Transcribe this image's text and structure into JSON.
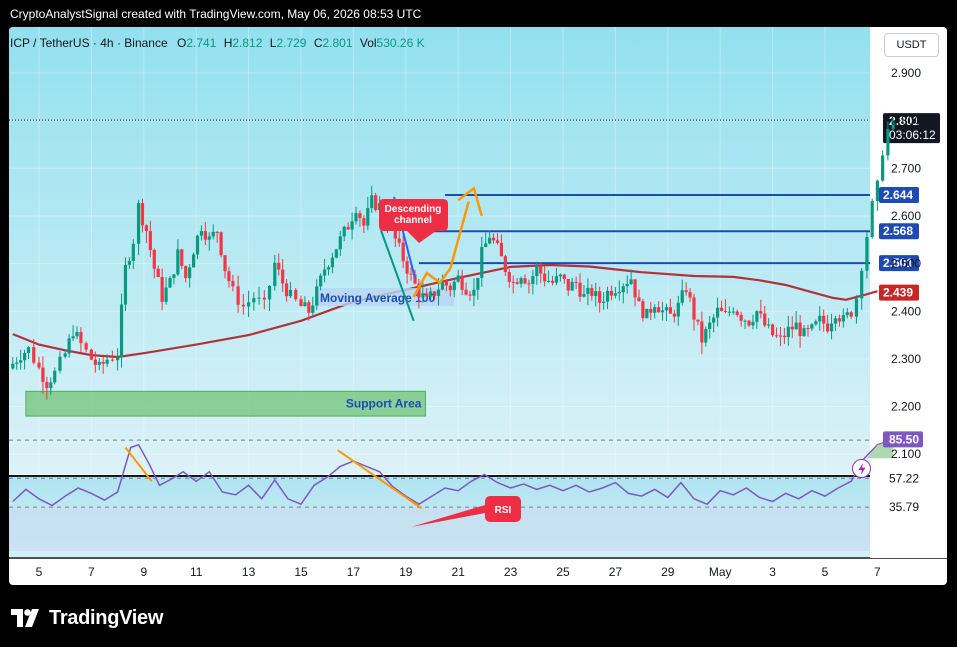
{
  "header": {
    "caption": "CryptoAnalystSignal created with TradingView.com, May 06, 2026 08:53 UTC"
  },
  "legend": {
    "symbol": "ICP / TetherUS · 4h · Binance",
    "open_label": "O",
    "open": "2.741",
    "high_label": "H",
    "high": "2.812",
    "low_label": "L",
    "low": "2.729",
    "close_label": "C",
    "close": "2.801",
    "vol_label": "Vol",
    "vol": "530.26 K"
  },
  "currency_button": "USDT",
  "brand": {
    "name": "TradingView",
    "icon": "tradingview-logo-icon"
  },
  "colors": {
    "bg_top": "#92e0ef",
    "bg_bottom": "#d7f1f6",
    "up": "#089981",
    "down": "#f23645",
    "ma": "#b2323a",
    "level": "#1e4bb3",
    "support_fill": "#7ec886",
    "rsi_line": "#7e57c2",
    "rsi_bg": "#c3e6f1",
    "annotation_red": "#ee2e45",
    "orange": "#ff9800",
    "teal": "#009688",
    "blue": "#2962ff"
  },
  "chart_data": {
    "type": "candlestick",
    "title": "ICP / TetherUS · 4h · Binance",
    "y_ticks": [
      "2.900",
      "2.800",
      "2.700",
      "2.600",
      "2.500",
      "2.400",
      "2.300",
      "2.200",
      "2.100"
    ],
    "y_range": [
      2.055,
      2.955
    ],
    "x_ticks": [
      "5",
      "7",
      "9",
      "11",
      "13",
      "15",
      "17",
      "19",
      "21",
      "23",
      "25",
      "27",
      "29",
      "May",
      "3",
      "5",
      "7"
    ],
    "current_price": {
      "value": 2.801,
      "label": "2.801",
      "countdown": "03:06:12"
    },
    "price_levels": [
      {
        "value": 2.644,
        "label": "2.644",
        "from": "Apr 21",
        "color": "#1e4bb3"
      },
      {
        "value": 2.568,
        "label": "2.568",
        "from": "Apr 20",
        "color": "#1e4bb3"
      },
      {
        "value": 2.501,
        "label": "2.501",
        "from": "Apr 20",
        "color": "#1e4bb3"
      }
    ],
    "moving_average": {
      "name": "Moving Average 100",
      "label_text": "Moving Average",
      "label_suffix": "100",
      "last_value": "2.439",
      "points": [
        [
          4.0,
          2.352
        ],
        [
          5.0,
          2.33
        ],
        [
          6.0,
          2.318
        ],
        [
          7.0,
          2.308
        ],
        [
          8.0,
          2.304
        ],
        [
          9.0,
          2.312
        ],
        [
          11.0,
          2.33
        ],
        [
          13.0,
          2.35
        ],
        [
          15.0,
          2.38
        ],
        [
          17.0,
          2.42
        ],
        [
          19.0,
          2.445
        ],
        [
          21.0,
          2.47
        ],
        [
          23.0,
          2.493
        ],
        [
          24.5,
          2.497
        ],
        [
          26.0,
          2.494
        ],
        [
          28.0,
          2.482
        ],
        [
          30.0,
          2.474
        ],
        [
          31.5,
          2.472
        ],
        [
          32.5,
          2.465
        ],
        [
          33.5,
          2.455
        ],
        [
          34.5,
          2.44
        ],
        [
          35.3,
          2.428
        ],
        [
          35.8,
          2.424
        ],
        [
          36.5,
          2.434
        ],
        [
          37.0,
          2.442
        ]
      ]
    },
    "support_area": {
      "label": "Support Area",
      "top": 2.232,
      "bottom": 2.18,
      "from": 4.5,
      "to": 19.75
    },
    "annotations": [
      {
        "text_line1": "Descending",
        "text_line2": "channel"
      },
      {
        "text": "RSI"
      }
    ],
    "close_path": [
      [
        4.0,
        2.29
      ],
      [
        4.3,
        2.31
      ],
      [
        4.6,
        2.32
      ],
      [
        5.0,
        2.28
      ],
      [
        5.3,
        2.25
      ],
      [
        5.6,
        2.27
      ],
      [
        6.0,
        2.31
      ],
      [
        6.3,
        2.36
      ],
      [
        6.6,
        2.33
      ],
      [
        7.0,
        2.3
      ],
      [
        7.3,
        2.28
      ],
      [
        7.6,
        2.3
      ],
      [
        8.0,
        2.31
      ],
      [
        8.3,
        2.49
      ],
      [
        8.6,
        2.55
      ],
      [
        8.8,
        2.62
      ],
      [
        9.1,
        2.57
      ],
      [
        9.4,
        2.49
      ],
      [
        9.7,
        2.43
      ],
      [
        10.0,
        2.46
      ],
      [
        10.3,
        2.52
      ],
      [
        10.6,
        2.47
      ],
      [
        10.9,
        2.53
      ],
      [
        11.2,
        2.58
      ],
      [
        11.5,
        2.55
      ],
      [
        11.8,
        2.57
      ],
      [
        12.1,
        2.49
      ],
      [
        12.4,
        2.44
      ],
      [
        12.8,
        2.41
      ],
      [
        13.2,
        2.43
      ],
      [
        13.6,
        2.41
      ],
      [
        14.0,
        2.5
      ],
      [
        14.3,
        2.46
      ],
      [
        14.6,
        2.43
      ],
      [
        15.0,
        2.41
      ],
      [
        15.3,
        2.4
      ],
      [
        15.6,
        2.44
      ],
      [
        15.9,
        2.49
      ],
      [
        16.2,
        2.52
      ],
      [
        16.5,
        2.55
      ],
      [
        16.8,
        2.58
      ],
      [
        17.1,
        2.62
      ],
      [
        17.4,
        2.58
      ],
      [
        17.7,
        2.63
      ],
      [
        18.0,
        2.62
      ],
      [
        18.3,
        2.59
      ],
      [
        18.6,
        2.55
      ],
      [
        18.9,
        2.51
      ],
      [
        19.2,
        2.47
      ],
      [
        19.5,
        2.44
      ],
      [
        19.8,
        2.42
      ],
      [
        20.1,
        2.44
      ],
      [
        20.4,
        2.46
      ],
      [
        20.7,
        2.45
      ],
      [
        21.0,
        2.47
      ],
      [
        21.3,
        2.45
      ],
      [
        21.6,
        2.44
      ],
      [
        21.9,
        2.52
      ],
      [
        22.2,
        2.56
      ],
      [
        22.5,
        2.53
      ],
      [
        22.8,
        2.49
      ],
      [
        23.1,
        2.46
      ],
      [
        23.4,
        2.48
      ],
      [
        23.7,
        2.46
      ],
      [
        24.0,
        2.49
      ],
      [
        24.3,
        2.47
      ],
      [
        24.6,
        2.46
      ],
      [
        24.9,
        2.47
      ],
      [
        25.2,
        2.45
      ],
      [
        25.5,
        2.46
      ],
      [
        25.8,
        2.43
      ],
      [
        26.1,
        2.44
      ],
      [
        26.4,
        2.42
      ],
      [
        26.7,
        2.44
      ],
      [
        27.0,
        2.45
      ],
      [
        27.3,
        2.46
      ],
      [
        27.6,
        2.47
      ],
      [
        27.9,
        2.41
      ],
      [
        28.2,
        2.39
      ],
      [
        28.5,
        2.42
      ],
      [
        28.8,
        2.4
      ],
      [
        29.1,
        2.39
      ],
      [
        29.4,
        2.41
      ],
      [
        29.7,
        2.45
      ],
      [
        30.0,
        2.39
      ],
      [
        30.3,
        2.34
      ],
      [
        30.6,
        2.37
      ],
      [
        30.9,
        2.4
      ],
      [
        31.2,
        2.39
      ],
      [
        31.5,
        2.41
      ],
      [
        31.8,
        2.39
      ],
      [
        32.1,
        2.38
      ],
      [
        32.4,
        2.4
      ],
      [
        32.7,
        2.37
      ],
      [
        33.0,
        2.35
      ],
      [
        33.3,
        2.34
      ],
      [
        33.6,
        2.36
      ],
      [
        33.9,
        2.37
      ],
      [
        34.2,
        2.35
      ],
      [
        34.5,
        2.36
      ],
      [
        34.8,
        2.38
      ],
      [
        35.1,
        2.37
      ],
      [
        35.4,
        2.4
      ],
      [
        35.7,
        2.38
      ],
      [
        36.0,
        2.4
      ],
      [
        36.2,
        2.43
      ],
      [
        36.4,
        2.5
      ],
      [
        36.6,
        2.56
      ],
      [
        36.8,
        2.62
      ],
      [
        37.0,
        2.66
      ],
      [
        37.2,
        2.74
      ],
      [
        37.4,
        2.78
      ],
      [
        37.6,
        2.8
      ]
    ],
    "rsi": {
      "levels": [
        "85.50",
        "57.22",
        "35.79"
      ],
      "values": [
        [
          4.0,
          40
        ],
        [
          4.5,
          49
        ],
        [
          5.0,
          42
        ],
        [
          5.5,
          37
        ],
        [
          6.0,
          44
        ],
        [
          6.5,
          50
        ],
        [
          7.0,
          46
        ],
        [
          7.5,
          41
        ],
        [
          8.0,
          47
        ],
        [
          8.5,
          80
        ],
        [
          8.8,
          82
        ],
        [
          9.2,
          68
        ],
        [
          9.6,
          52
        ],
        [
          10.0,
          56
        ],
        [
          10.5,
          62
        ],
        [
          11.0,
          55
        ],
        [
          11.5,
          62
        ],
        [
          12.0,
          47
        ],
        [
          12.5,
          45
        ],
        [
          13.0,
          52
        ],
        [
          13.5,
          42
        ],
        [
          14.0,
          56
        ],
        [
          14.5,
          42
        ],
        [
          15.0,
          38
        ],
        [
          15.5,
          52
        ],
        [
          16.0,
          58
        ],
        [
          16.5,
          66
        ],
        [
          17.0,
          70
        ],
        [
          17.5,
          66
        ],
        [
          18.0,
          62
        ],
        [
          18.5,
          51
        ],
        [
          19.0,
          44
        ],
        [
          19.5,
          38
        ],
        [
          20.0,
          44
        ],
        [
          20.5,
          50
        ],
        [
          21.0,
          48
        ],
        [
          21.5,
          55
        ],
        [
          22.0,
          60
        ],
        [
          22.5,
          54
        ],
        [
          23.0,
          50
        ],
        [
          23.5,
          53
        ],
        [
          24.0,
          49
        ],
        [
          24.5,
          52
        ],
        [
          25.0,
          48
        ],
        [
          25.5,
          52
        ],
        [
          26.0,
          47
        ],
        [
          26.5,
          50
        ],
        [
          27.0,
          54
        ],
        [
          27.5,
          46
        ],
        [
          28.0,
          44
        ],
        [
          28.5,
          49
        ],
        [
          29.0,
          43
        ],
        [
          29.5,
          54
        ],
        [
          30.0,
          42
        ],
        [
          30.5,
          38
        ],
        [
          31.0,
          48
        ],
        [
          31.5,
          45
        ],
        [
          32.0,
          50
        ],
        [
          32.5,
          43
        ],
        [
          33.0,
          40
        ],
        [
          33.5,
          46
        ],
        [
          34.0,
          42
        ],
        [
          34.5,
          48
        ],
        [
          35.0,
          44
        ],
        [
          35.5,
          50
        ],
        [
          36.0,
          55
        ],
        [
          36.5,
          72
        ],
        [
          37.0,
          82
        ],
        [
          37.6,
          86
        ]
      ]
    }
  }
}
